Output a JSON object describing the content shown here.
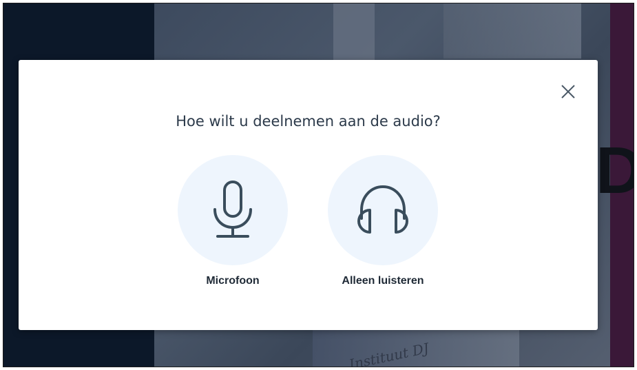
{
  "background": {
    "caption": "Instituut DJ"
  },
  "modal": {
    "title": "Hoe wilt u deelnemen aan de audio?",
    "close_icon": "close-icon",
    "options": [
      {
        "label": "Microfoon",
        "icon": "microphone-icon"
      },
      {
        "label": "Alleen luisteren",
        "icon": "headphones-icon"
      }
    ]
  },
  "annotation": {
    "arrow_color": "#3b1569"
  },
  "colors": {
    "option_circle": "#eef5fd",
    "icon_stroke": "#3a4d5c",
    "title_text": "#2c3a4a"
  }
}
